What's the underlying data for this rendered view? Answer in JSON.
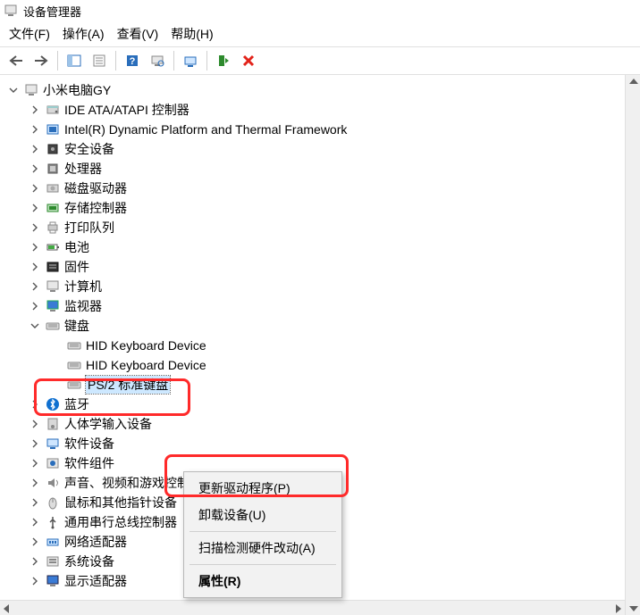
{
  "window": {
    "title": "设备管理器"
  },
  "menu": {
    "file": "文件(F)",
    "action": "操作(A)",
    "view": "查看(V)",
    "help": "帮助(H)"
  },
  "tree": {
    "root": "小米电脑GY",
    "items": [
      "IDE ATA/ATAPI 控制器",
      "Intel(R) Dynamic Platform and Thermal Framework",
      "安全设备",
      "处理器",
      "磁盘驱动器",
      "存储控制器",
      "打印队列",
      "电池",
      "固件",
      "计算机",
      "监视器"
    ],
    "keyboard": {
      "label": "键盘",
      "children": [
        "HID Keyboard Device",
        "HID Keyboard Device",
        "PS/2 标准键盘"
      ]
    },
    "rest": [
      "蓝牙",
      "人体学输入设备",
      "软件设备",
      "软件组件",
      "声音、视频和游戏控制器",
      "鼠标和其他指针设备",
      "通用串行总线控制器",
      "网络适配器",
      "系统设备",
      "显示适配器"
    ]
  },
  "context_menu": {
    "update_driver": "更新驱动程序(P)",
    "uninstall": "卸载设备(U)",
    "scan_hw": "扫描检测硬件改动(A)",
    "properties": "属性(R)"
  }
}
